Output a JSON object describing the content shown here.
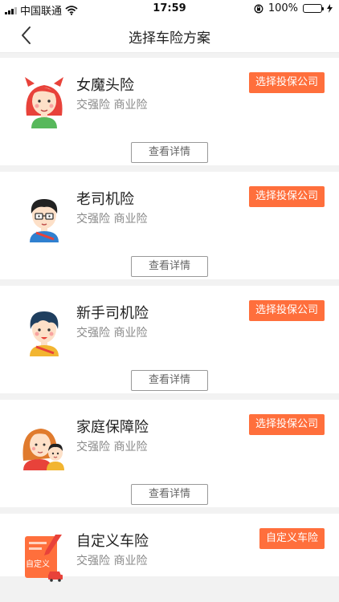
{
  "status_bar": {
    "carrier": "中国联通",
    "time": "17:59",
    "battery_percent": "100%",
    "battery_level": 1.0
  },
  "nav": {
    "title": "选择车险方案",
    "back_icon": "chevron-left-icon"
  },
  "plans": [
    {
      "name": "女魔头险",
      "coverage": "交强险 商业险",
      "action_label": "选择投保公司",
      "detail_label": "查看详情",
      "avatar_icon": "devil-woman-avatar-icon"
    },
    {
      "name": "老司机险",
      "coverage": "交强险 商业险",
      "action_label": "选择投保公司",
      "detail_label": "查看详情",
      "avatar_icon": "glasses-man-avatar-icon"
    },
    {
      "name": "新手司机险",
      "coverage": "交强险 商业险",
      "action_label": "选择投保公司",
      "detail_label": "查看详情",
      "avatar_icon": "young-man-avatar-icon"
    },
    {
      "name": "家庭保障险",
      "coverage": "交强险 商业险",
      "action_label": "选择投保公司",
      "detail_label": "查看详情",
      "avatar_icon": "mother-child-avatar-icon"
    },
    {
      "name": "自定义车险",
      "coverage": "交强险 商业险",
      "action_label": "自定义车险",
      "avatar_icon": "custom-document-icon",
      "avatar_text": "自定义"
    }
  ],
  "colors": {
    "accent": "#ff6f3c",
    "background": "#f2f2f2",
    "card": "#ffffff",
    "battery": "#3cc84a"
  }
}
